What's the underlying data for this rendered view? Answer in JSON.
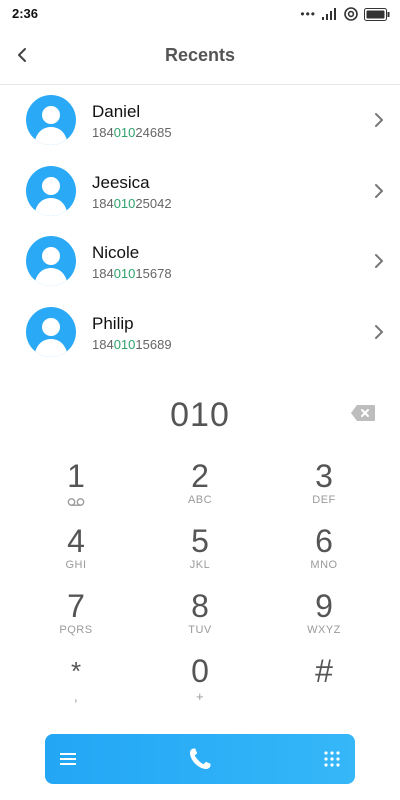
{
  "status_bar": {
    "time": "2:36",
    "icons": [
      "more-dots-icon",
      "signal-icon",
      "wifi-icon",
      "battery-icon"
    ]
  },
  "header": {
    "title": "Recents",
    "back_icon": "back-arrow-icon"
  },
  "contacts": [
    {
      "name": "Daniel",
      "number_prefix": "184",
      "number_match": "010",
      "number_suffix": "24685"
    },
    {
      "name": "Jeesica",
      "number_prefix": "184",
      "number_match": "010",
      "number_suffix": "25042"
    },
    {
      "name": "Nicole",
      "number_prefix": "184",
      "number_match": "010",
      "number_suffix": "15678"
    },
    {
      "name": "Philip",
      "number_prefix": "184",
      "number_match": "010",
      "number_suffix": "15689"
    }
  ],
  "dialer": {
    "input": "010",
    "keys": [
      {
        "digit": "1",
        "letters": ""
      },
      {
        "digit": "2",
        "letters": "ABC"
      },
      {
        "digit": "3",
        "letters": "DEF"
      },
      {
        "digit": "4",
        "letters": "GHI"
      },
      {
        "digit": "5",
        "letters": "JKL"
      },
      {
        "digit": "6",
        "letters": "MNO"
      },
      {
        "digit": "7",
        "letters": "PQRS"
      },
      {
        "digit": "8",
        "letters": "TUV"
      },
      {
        "digit": "9",
        "letters": "WXYZ"
      },
      {
        "digit": "*",
        "letters": ","
      },
      {
        "digit": "0",
        "letters": "+"
      },
      {
        "digit": "#",
        "letters": ""
      }
    ]
  },
  "colors": {
    "accent": "#2aa9f6",
    "match_highlight": "#2fa36b",
    "avatar_bg": "#2aa9f6"
  }
}
